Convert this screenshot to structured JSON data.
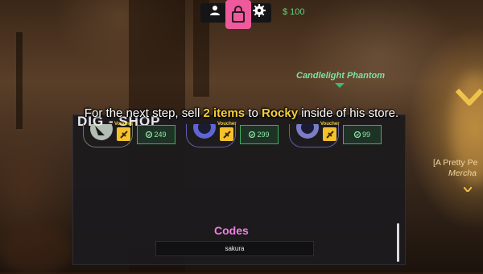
{
  "hud": {
    "money": "$ 100",
    "icons": [
      "user-icon",
      "shopping-bag-icon",
      "gear-icon"
    ]
  },
  "world": {
    "npc_name": "Candlelight Phantom",
    "npc2_name": "[A Pretty Pe",
    "npc2_subtitle": "Mercha"
  },
  "tutorial": {
    "part1": "For the next step, sell ",
    "item_count": "2 items",
    "part2": " to ",
    "npc": "Rocky",
    "part3": " inside of his store."
  },
  "shop": {
    "title": "DIG - SHOP",
    "items": [
      {
        "voucher_label": "Voucher",
        "price": "249"
      },
      {
        "voucher_label": "Voucher",
        "price": "299"
      },
      {
        "voucher_label": "Voucher",
        "price": "99"
      }
    ],
    "codes": {
      "title": "Codes",
      "input_value": "sakura"
    }
  },
  "colors": {
    "accent_pink": "#ee5a9c",
    "money_green": "#5dd47a",
    "highlight_yellow": "#f6cf3a",
    "codes_pink": "#f07fe0"
  }
}
